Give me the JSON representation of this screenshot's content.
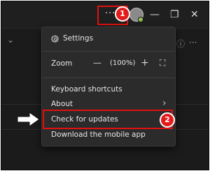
{
  "window": {
    "more_options": "···",
    "minimize_glyph": "—",
    "restore_glyph": "❐",
    "close_glyph": "✕"
  },
  "annotations": {
    "step1": "1",
    "step2": "2"
  },
  "background": {
    "more_glyph": "···",
    "chevron_glyph": "⌄"
  },
  "menu": {
    "settings": "Settings",
    "zoom": {
      "label": "Zoom",
      "minus": "—",
      "value": "(100%)",
      "plus": "+",
      "fullscreen": "⛶"
    },
    "keyboard_shortcuts": "Keyboard shortcuts",
    "about": "About",
    "about_chevron": "›",
    "check_for_updates": "Check for updates",
    "download_mobile": "Download the mobile app"
  },
  "colors": {
    "accent_red": "#e01010",
    "presence_green": "#92c353"
  }
}
